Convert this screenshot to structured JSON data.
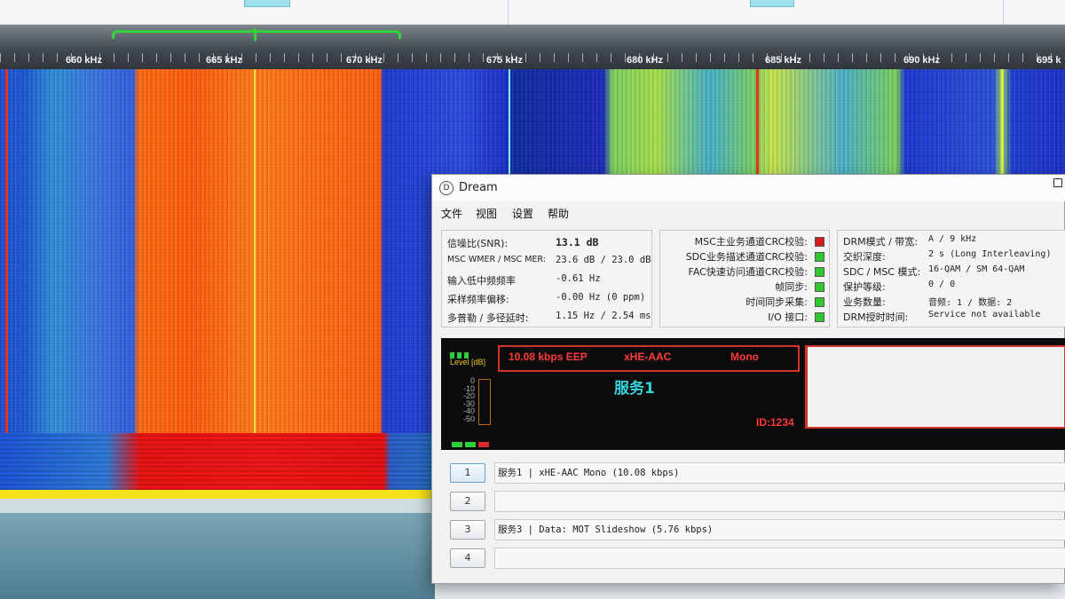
{
  "spectrum": {
    "freq_labels": [
      "660 kHz",
      "665 kHz",
      "670 kHz",
      "675 kHz",
      "680 kHz",
      "685 kHz",
      "690 kHz",
      "695 k"
    ]
  },
  "window": {
    "icon_glyph": "D",
    "title": "Dream"
  },
  "menu": [
    "文件",
    "视图",
    "设置",
    "帮助"
  ],
  "signal_panel": [
    {
      "label": "信噪比(SNR):",
      "value": "13.1 dB"
    },
    {
      "label": "MSC WMER / MSC MER:",
      "value": "23.6 dB / 23.0 dB"
    },
    {
      "label": "输入低中频频率",
      "value": "-0.61 Hz"
    },
    {
      "label": "采样频率偏移:",
      "value": "-0.00 Hz (0 ppm)"
    },
    {
      "label": "多普勒 / 多径延时:",
      "value": "1.15 Hz / 2.54 ms"
    }
  ],
  "status_panel": [
    {
      "label": "MSC主业务通道CRC校验:",
      "color": "#d41e1e"
    },
    {
      "label": "SDC业务描述通道CRC校验:",
      "color": "#32c832"
    },
    {
      "label": "FAC快速访问通道CRC校验:",
      "color": "#32c832"
    },
    {
      "label": "帧同步:",
      "color": "#32c832"
    },
    {
      "label": "时间同步采集:",
      "color": "#32c832"
    },
    {
      "label": "I/O 接口:",
      "color": "#32c832"
    }
  ],
  "mode_panel": [
    {
      "label": "DRM模式 / 带宽:",
      "value": "A / 9 kHz"
    },
    {
      "label": "交织深度:",
      "value": "2 s (Long Interleaving)"
    },
    {
      "label": "SDC / MSC 模式:",
      "value": "16-QAM / SM 64-QAM"
    },
    {
      "label": "保护等级:",
      "value": "0 / 0"
    },
    {
      "label": "业务数量:",
      "value": "音频: 1 / 数据: 2"
    },
    {
      "label": "DRM授时时间:",
      "value": "Service not available"
    }
  ],
  "audio_display": {
    "level_label": "Level [dB]",
    "level_scale": [
      "0",
      "-10",
      "-20",
      "-30",
      "-40",
      "-50"
    ],
    "bitrate": "10.08 kbps EEP",
    "codec": "xHE-AAC",
    "channels": "Mono",
    "service_name": "服务1",
    "service_id": "ID:1234",
    "status_leds": [
      "#2ccf3c",
      "#2ccf3c",
      "#e0262a"
    ]
  },
  "services": [
    {
      "num": "1",
      "text": "服务1  |  xHE-AAC Mono (10.08 kbps)"
    },
    {
      "num": "2",
      "text": ""
    },
    {
      "num": "3",
      "text": "服务3  |  Data: MOT Slideshow (5.76 kbps)"
    },
    {
      "num": "4",
      "text": ""
    }
  ]
}
